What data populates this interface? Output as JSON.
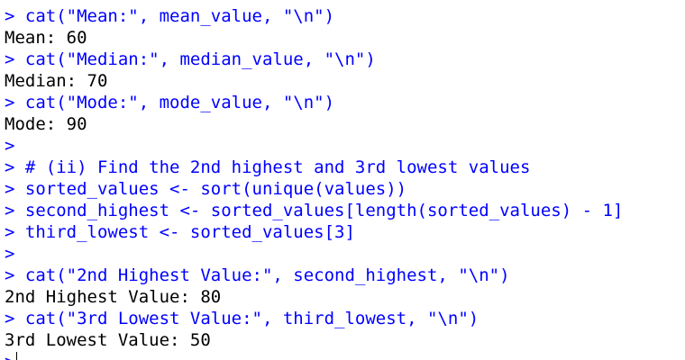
{
  "colors": {
    "input": "#0000ff",
    "output": "#000000",
    "background": "#ffffff"
  },
  "console": {
    "lines": [
      {
        "type": "input",
        "text": "> cat(\"Mean:\", mean_value, \"\\n\")"
      },
      {
        "type": "output",
        "text": "Mean: 60"
      },
      {
        "type": "input",
        "text": "> cat(\"Median:\", median_value, \"\\n\")"
      },
      {
        "type": "output",
        "text": "Median: 70"
      },
      {
        "type": "input",
        "text": "> cat(\"Mode:\", mode_value, \"\\n\")"
      },
      {
        "type": "output",
        "text": "Mode: 90"
      },
      {
        "type": "input",
        "text": ">"
      },
      {
        "type": "input",
        "text": "> # (ii) Find the 2nd highest and 3rd lowest values"
      },
      {
        "type": "input",
        "text": "> sorted_values <- sort(unique(values))"
      },
      {
        "type": "input",
        "text": "> second_highest <- sorted_values[length(sorted_values) - 1]"
      },
      {
        "type": "input",
        "text": "> third_lowest <- sorted_values[3]"
      },
      {
        "type": "input",
        "text": ">"
      },
      {
        "type": "input",
        "text": "> cat(\"2nd Highest Value:\", second_highest, \"\\n\")"
      },
      {
        "type": "output",
        "text": "2nd Highest Value: 80"
      },
      {
        "type": "input",
        "text": "> cat(\"3rd Lowest Value:\", third_lowest, \"\\n\")"
      },
      {
        "type": "output",
        "text": "3rd Lowest Value: 50"
      }
    ],
    "prompt": ">"
  }
}
